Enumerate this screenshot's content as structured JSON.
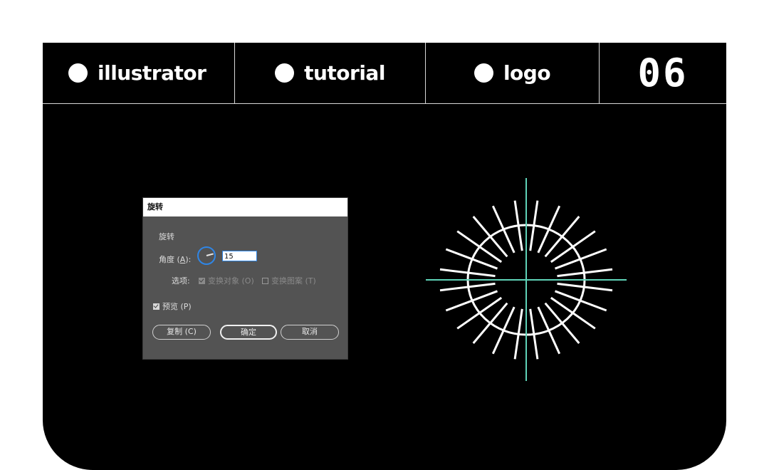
{
  "header": {
    "cells": [
      {
        "label": "illustrator"
      },
      {
        "label": "tutorial"
      },
      {
        "label": "logo"
      }
    ],
    "number": "06"
  },
  "dialog": {
    "title": "旋转",
    "section_title": "旋转",
    "angle_label_prefix": "角度 (",
    "angle_label_key": "A",
    "angle_label_suffix": "):",
    "angle_value": "15",
    "options_label": "选项:",
    "option_transform_objects": {
      "label": "变换对象 (O)",
      "checked": true
    },
    "option_transform_patterns": {
      "label": "变换图案 (T)",
      "checked": false
    },
    "preview": {
      "label": "预览 (P)",
      "checked": true
    },
    "buttons": {
      "copy": "复制 (C)",
      "ok": "确定",
      "cancel": "取消"
    },
    "accent_color": "#2f86e6"
  },
  "artwork": {
    "ray_count": 24,
    "rotation_step_degrees": 15,
    "ray_color": "#ffffff",
    "guide_color": "#5fd3b8"
  }
}
